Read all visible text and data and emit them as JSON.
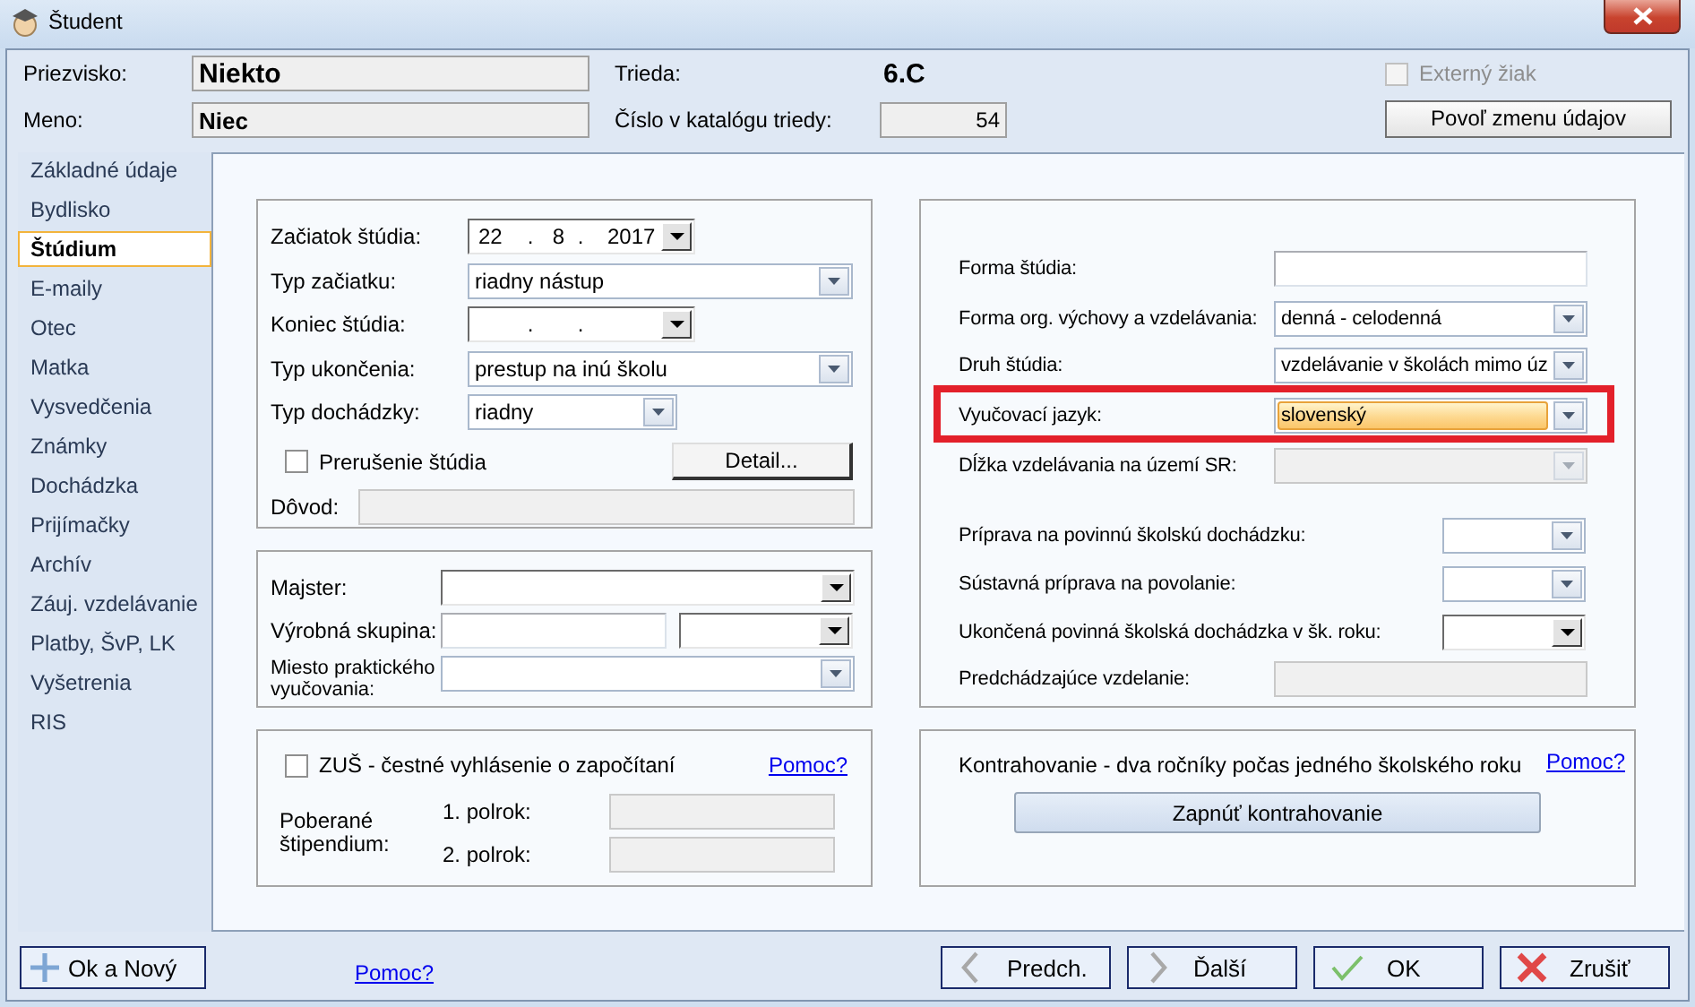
{
  "window": {
    "title": "Študent"
  },
  "header": {
    "surname": {
      "label": "Priezvisko:",
      "value": "Niekto"
    },
    "name": {
      "label": "Meno:",
      "value": "Niec"
    },
    "class": {
      "label": "Trieda:",
      "value": "6.C"
    },
    "catalog_number": {
      "label": "Číslo v katalógu triedy:",
      "value": "54"
    },
    "external_student": {
      "label": "Externý žiak",
      "checked": false,
      "disabled": true
    },
    "unlock_button": "Povoľ zmenu údajov"
  },
  "sidebar": {
    "items": [
      {
        "label": "Základné údaje",
        "selected": false
      },
      {
        "label": "Bydlisko",
        "selected": false
      },
      {
        "label": "Štúdium",
        "selected": true
      },
      {
        "label": "E-maily",
        "selected": false
      },
      {
        "label": "Otec",
        "selected": false
      },
      {
        "label": "Matka",
        "selected": false
      },
      {
        "label": "Vysvedčenia",
        "selected": false
      },
      {
        "label": "Známky",
        "selected": false
      },
      {
        "label": "Dochádzka",
        "selected": false
      },
      {
        "label": "Prijímačky",
        "selected": false
      },
      {
        "label": "Archív",
        "selected": false
      },
      {
        "label": "Záuj. vzdelávanie",
        "selected": false
      },
      {
        "label": "Platby, ŠvP, LK",
        "selected": false
      },
      {
        "label": "Vyšetrenia",
        "selected": false
      },
      {
        "label": "RIS",
        "selected": false
      }
    ]
  },
  "study": {
    "rows": [
      {
        "kind": "date",
        "label": "Začiatok štúdia:",
        "day": "22",
        "month": "8",
        "year": "2017",
        "separator": "."
      },
      {
        "kind": "combo",
        "label": "Typ začiatku:",
        "value": "riadny nástup"
      },
      {
        "kind": "date",
        "label": "Koniec štúdia:",
        "separator": "."
      },
      {
        "kind": "combo",
        "label": "Typ ukončenia:",
        "value": "prestup na inú školu"
      },
      {
        "kind": "combo",
        "label": "Typ dochádzky:",
        "value": "riadny"
      }
    ],
    "interruption": {
      "label": "Prerušenie štúdia",
      "checked": false
    },
    "detail_button": "Detail...",
    "reason": {
      "label": "Dôvod:",
      "disabled": true
    }
  },
  "practice": {
    "master": {
      "label": "Majster:"
    },
    "production_group": {
      "label": "Výrobná skupina:"
    },
    "place": {
      "label": "Miesto praktického vyučovania:"
    }
  },
  "art_school": {
    "declaration": {
      "label": "ZUŠ - čestné vyhlásenie o započítaní",
      "checked": false
    },
    "help_link": "Pomoc?",
    "scholarship_label": "Poberané štipendium:",
    "terms": [
      {
        "label": "1. polrok:",
        "disabled": true
      },
      {
        "label": "2. polrok:",
        "disabled": true
      }
    ]
  },
  "education": {
    "rows": [
      {
        "kind": "text",
        "label": "Forma štúdia:",
        "disabled": false,
        "highlighted": false,
        "focused": false
      },
      {
        "kind": "combo",
        "label": "Forma org. výchovy a vzdelávania:",
        "value": "denná - celodenná",
        "disabled": false,
        "highlighted": false,
        "focused": false
      },
      {
        "kind": "combo",
        "label": "Druh štúdia:",
        "value": "vzdelávanie v školách mimo úz",
        "disabled": false,
        "highlighted": false,
        "focused": false
      },
      {
        "kind": "combo",
        "label": "Vyučovací jazyk:",
        "value": "slovenský",
        "disabled": false,
        "highlighted": true,
        "focused": true
      },
      {
        "kind": "combo",
        "label": "Dĺžka vzdelávania na území SR:",
        "disabled": true,
        "highlighted": false,
        "focused": false
      },
      {
        "kind": "combo",
        "label": "Príprava na povinnú školskú dochádzku:",
        "disabled": false,
        "highlighted": false,
        "focused": false
      },
      {
        "kind": "combo",
        "label": "Sústavná príprava na povolanie:",
        "disabled": false,
        "highlighted": false,
        "focused": false
      },
      {
        "kind": "dropdown",
        "label": "Ukončená povinná školská dochádzka v šk. roku:",
        "disabled": false,
        "highlighted": false,
        "focused": false
      },
      {
        "kind": "text",
        "label": "Predchádzajúce vzdelanie:",
        "disabled": true,
        "highlighted": false,
        "focused": false
      }
    ]
  },
  "contracting": {
    "text": "Kontrahovanie - dva ročníky počas jedného školského roku",
    "help_link": "Pomoc?",
    "button": "Zapnúť kontrahovanie"
  },
  "footer": {
    "ok_new_button": "Ok a Nový",
    "help_link": "Pomoc?",
    "nav_buttons": [
      {
        "kind": "previous",
        "label": "Predch."
      },
      {
        "kind": "next",
        "label": "Ďalší"
      },
      {
        "kind": "ok",
        "label": "OK"
      },
      {
        "kind": "cancel",
        "label": "Zrušiť"
      }
    ]
  }
}
